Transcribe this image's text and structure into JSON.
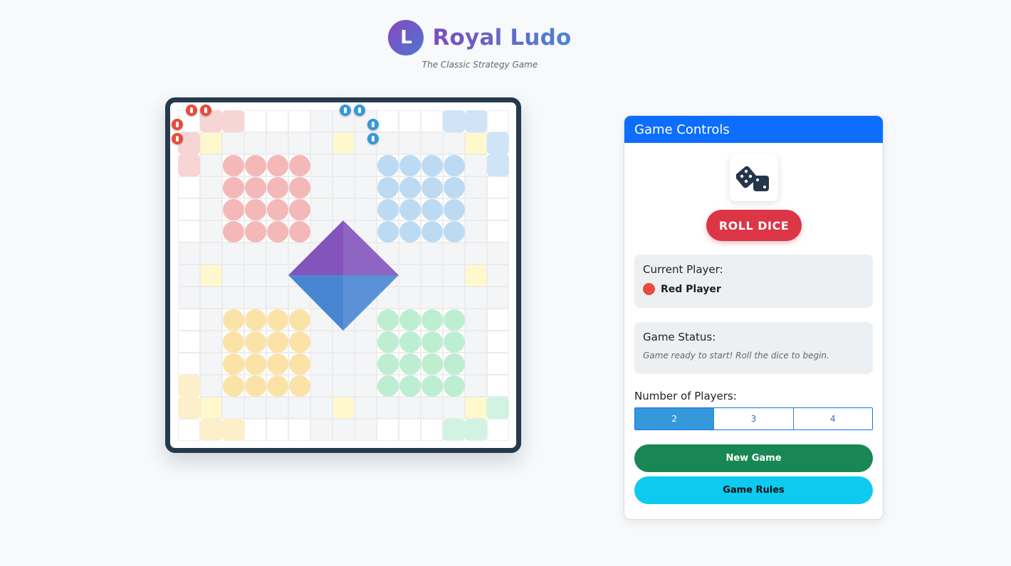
{
  "header": {
    "logo_letter": "L",
    "title": "Royal Ludo",
    "subtitle": "The Classic Strategy Game"
  },
  "board": {
    "colors": {
      "red": "#e74c3c",
      "blue": "#3498db",
      "yellow": "#f1c40f",
      "green": "#2ecc71",
      "center_top": "#7b4bb8",
      "center_bottom": "#3f7fd0",
      "frame": "#26394d"
    }
  },
  "controls": {
    "title": "Game Controls",
    "dice_icon": "dice-icon",
    "roll_label": "ROLL DICE",
    "current_player_label": "Current Player:",
    "current_player_name": "Red Player",
    "current_player_color": "#e74c3c",
    "status_label": "Game Status:",
    "status_text": "Game ready to start! Roll the dice to begin.",
    "num_players_label": "Number of Players:",
    "num_players_options": [
      "2",
      "3",
      "4"
    ],
    "num_players_selected": "2",
    "new_game_label": "New Game",
    "rules_label": "Game Rules"
  }
}
